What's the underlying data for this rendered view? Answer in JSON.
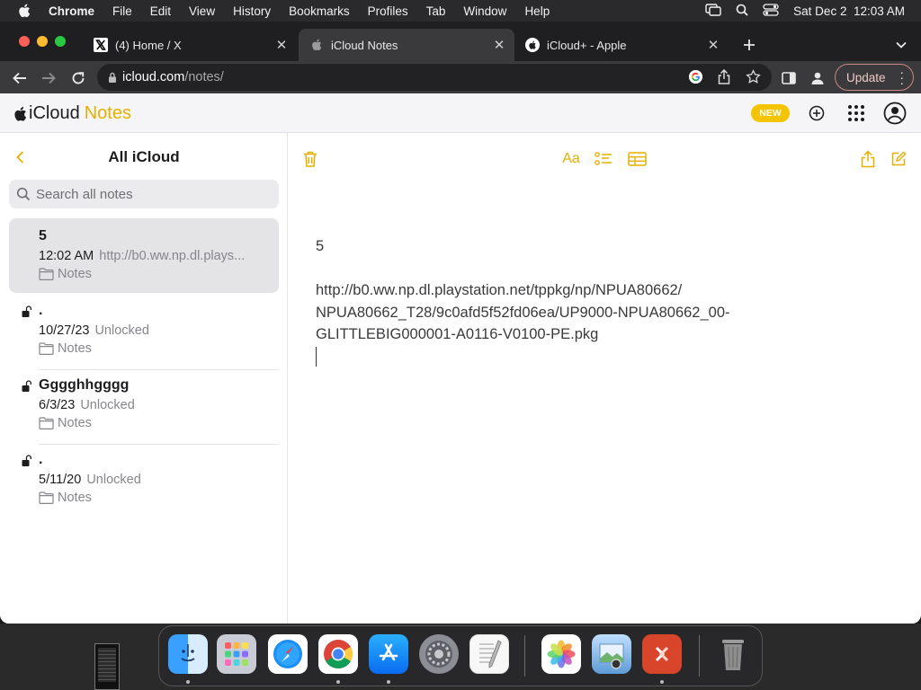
{
  "menubar": {
    "app": "Chrome",
    "items": [
      "File",
      "Edit",
      "View",
      "History",
      "Bookmarks",
      "Profiles",
      "Tab",
      "Window",
      "Help"
    ],
    "clock": "Sat Dec 2  12:03 AM"
  },
  "tabs": [
    {
      "title": "(4) Home / X",
      "icon": "x-logo-icon",
      "active": false
    },
    {
      "title": "iCloud Notes",
      "icon": "apple-logo-icon",
      "active": true
    },
    {
      "title": "iCloud+ - Apple",
      "icon": "apple-logo-icon",
      "active": false
    }
  ],
  "address": {
    "domain": "icloud.com",
    "path": "/notes/",
    "update_label": "Update"
  },
  "app": {
    "brand_icloud": "iCloud",
    "brand_notes": "Notes",
    "new_badge": "NEW",
    "colors": {
      "accent": "#e6b000",
      "badge": "#f5c400"
    }
  },
  "sidebar": {
    "title": "All iCloud",
    "search_placeholder": "Search all notes",
    "notes": [
      {
        "title": "5",
        "date": "12:02 AM",
        "preview": "http://b0.ww.np.dl.plays...",
        "folder": "Notes",
        "locked": false,
        "selected": true
      },
      {
        "title": ".",
        "date": "10/27/23",
        "preview": "Unlocked",
        "folder": "Notes",
        "locked": true,
        "selected": false
      },
      {
        "title": "Gggghhgggg",
        "date": "6/3/23",
        "preview": "Unlocked",
        "folder": "Notes",
        "locked": true,
        "selected": false
      },
      {
        "title": ".",
        "date": "5/11/20",
        "preview": "Unlocked",
        "folder": "Notes",
        "locked": true,
        "selected": false
      }
    ]
  },
  "editor": {
    "format_label": "Aa",
    "title_line": "5",
    "body_line1": "http://b0.ww.np.dl.playstation.net/tppkg/np/NPUA80662/",
    "body_line2": "NPUA80662_T28/9c0afd5f52fd06ea/UP9000-NPUA80662_00-",
    "body_line3": "GLITTLEBIG000001-A0116-V0100-PE.pkg"
  },
  "dock": {
    "apps": [
      "finder-icon",
      "launchpad-icon",
      "safari-icon",
      "chrome-icon",
      "app-store-icon",
      "system-settings-icon",
      "textedit-icon",
      "photos-icon",
      "preview-icon",
      "remote-desktop-icon",
      "trash-icon"
    ]
  }
}
